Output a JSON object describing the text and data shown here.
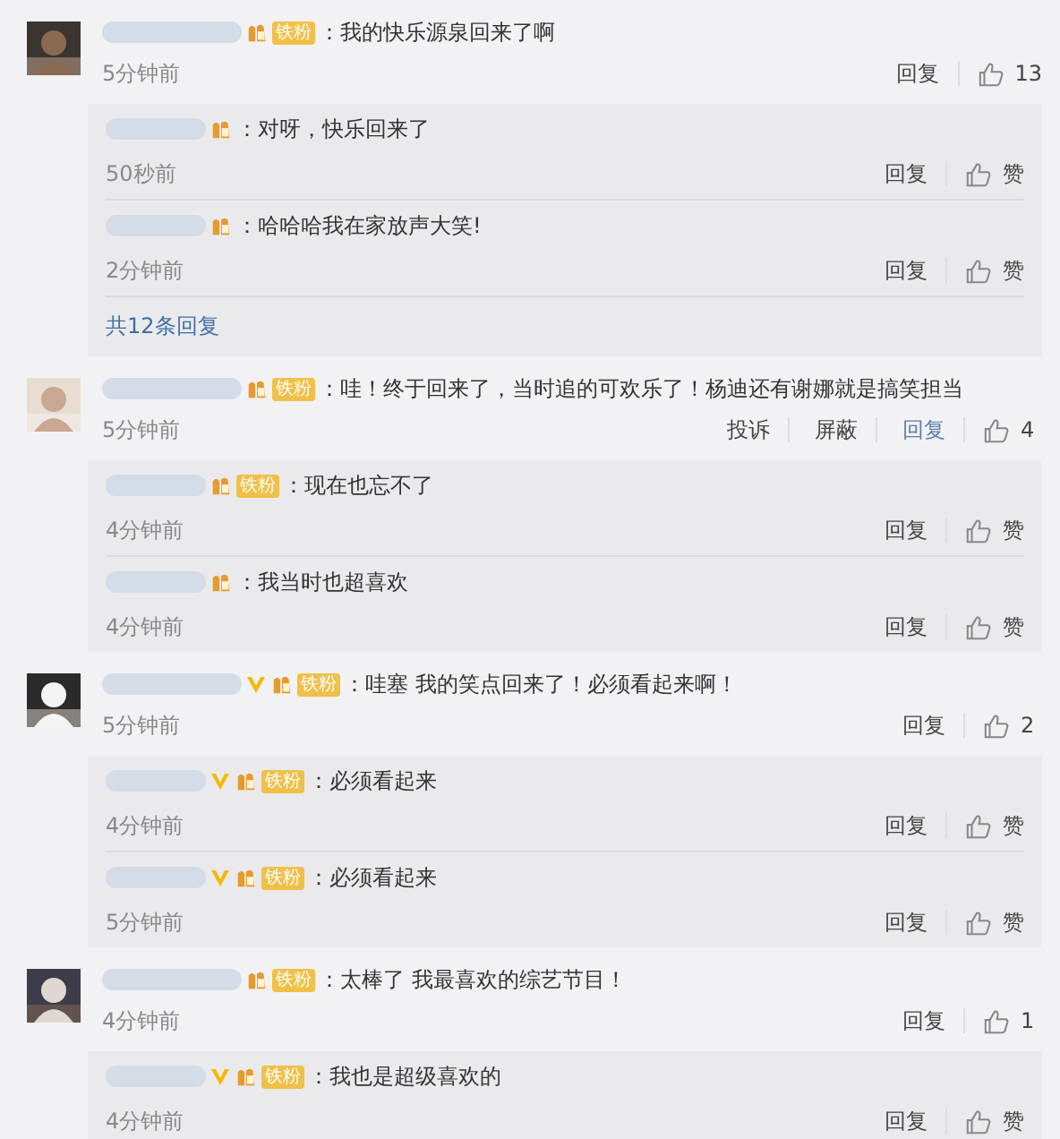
{
  "comments": [
    {
      "badge": "铁粉",
      "verified": false,
      "text": "：我的快乐源泉回来了啊",
      "time": "5分钟前",
      "actions": [
        {
          "label": "回复",
          "highlighted": false
        }
      ],
      "likes": "13",
      "replies": [
        {
          "verified": false,
          "text": "：对呀，快乐回来了",
          "time": "50秒前",
          "reply": "回复",
          "likes": "赞"
        },
        {
          "verified": false,
          "text": "：哈哈哈我在家放声大笑!",
          "time": "2分钟前",
          "reply": "回复",
          "likes": "赞"
        }
      ],
      "more": "共12条回复"
    },
    {
      "badge": "铁粉",
      "verified": false,
      "text": "：哇！终于回来了，当时追的可欢乐了！杨迪还有谢娜就是搞笑担当",
      "time": "5分钟前",
      "actions": [
        {
          "label": "投诉",
          "highlighted": false
        },
        {
          "label": "屏蔽",
          "highlighted": false
        },
        {
          "label": "回复",
          "highlighted": true
        }
      ],
      "likes": "4",
      "replies": [
        {
          "badge": "铁粉",
          "verified": false,
          "text": "：现在也忘不了",
          "time": "4分钟前",
          "reply": "回复",
          "likes": "赞"
        },
        {
          "verified": false,
          "text": "：我当时也超喜欢",
          "time": "4分钟前",
          "reply": "回复",
          "likes": "赞"
        }
      ]
    },
    {
      "badge": "铁粉",
      "verified": true,
      "text": "：哇塞 我的笑点回来了！必须看起来啊！",
      "time": "5分钟前",
      "actions": [
        {
          "label": "回复",
          "highlighted": false
        }
      ],
      "likes": "2",
      "replies": [
        {
          "badge": "铁粉",
          "verified": true,
          "text": "：必须看起来",
          "time": "4分钟前",
          "reply": "回复",
          "likes": "赞"
        },
        {
          "badge": "铁粉",
          "verified": true,
          "text": "：必须看起来",
          "time": "5分钟前",
          "reply": "回复",
          "likes": "赞"
        }
      ]
    },
    {
      "badge": "铁粉",
      "verified": false,
      "text": "：太棒了 我最喜欢的综艺节目！",
      "time": "4分钟前",
      "actions": [
        {
          "label": "回复",
          "highlighted": false
        }
      ],
      "likes": "1",
      "replies": [
        {
          "badge": "铁粉",
          "verified": true,
          "text": "：我也是超级喜欢的",
          "time": "4分钟前",
          "reply": "回复",
          "likes": "赞"
        }
      ]
    }
  ]
}
